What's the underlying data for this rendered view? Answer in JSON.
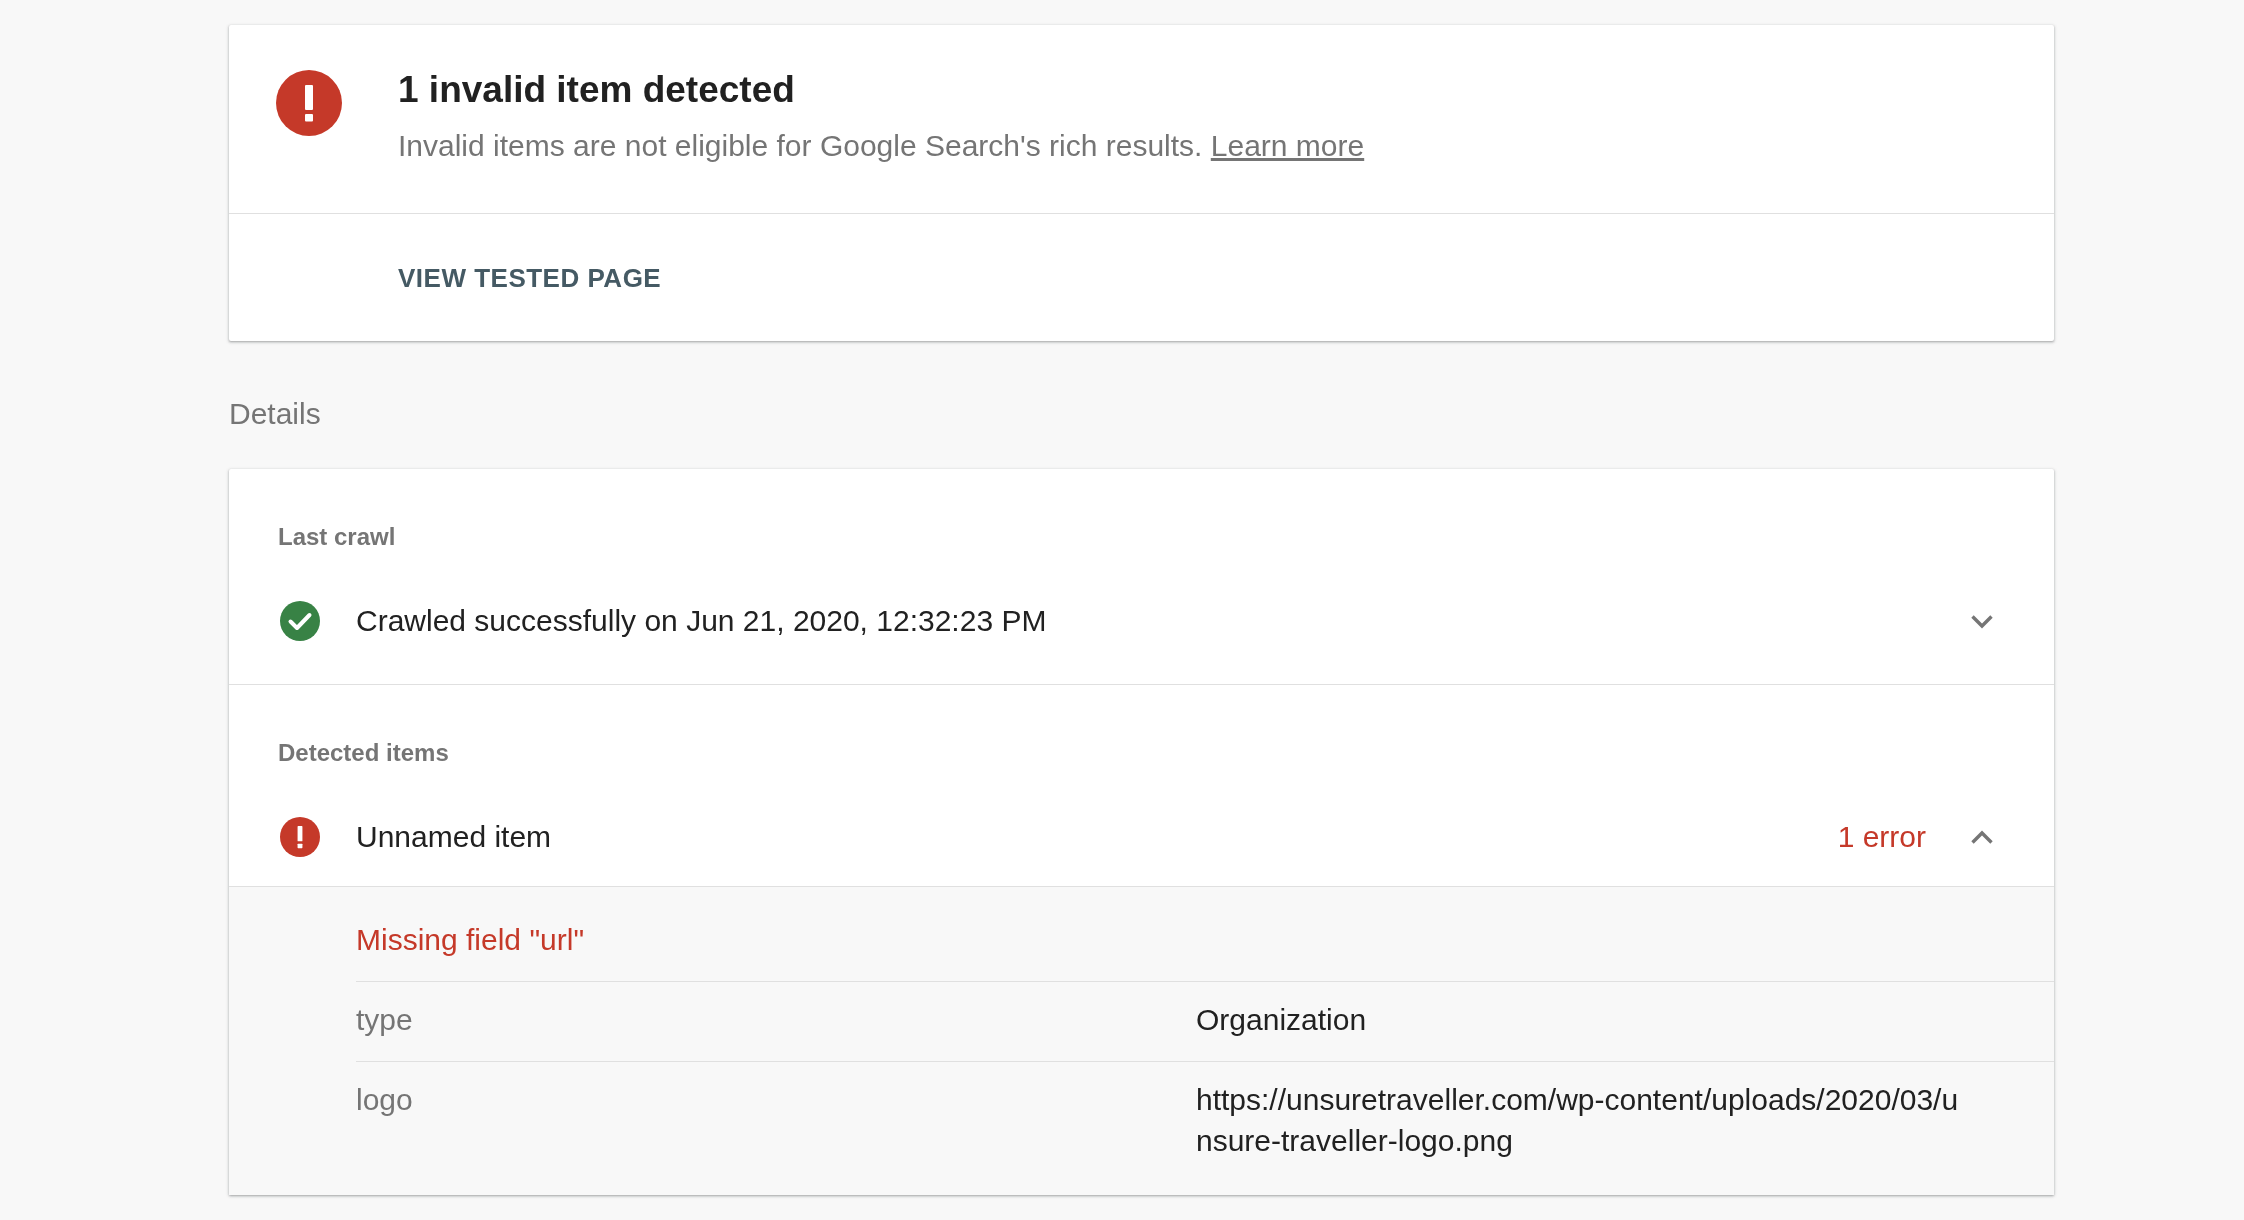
{
  "summary": {
    "kind": "error",
    "title": "1 invalid item detected",
    "description": "Invalid items are not eligible for Google Search's rich results.",
    "link": "Learn more",
    "action": "VIEW TESTED PAGE"
  },
  "details": {
    "heading": "Details",
    "sections": [
      {
        "label": "Last crawl",
        "kind": "success",
        "text": "Crawled successfully on Jun 21, 2020, 12:32:23 PM",
        "expanded": false
      },
      {
        "label": "Detected items",
        "kind": "error",
        "text": "Unnamed item",
        "count": "1 error",
        "expanded": true,
        "issues": [
          "Missing field \"url\""
        ],
        "fields": [
          {
            "name": "type",
            "value": "Organization"
          },
          {
            "name": "logo",
            "value": "https://unsuretraveller.com/wp-content/uploads/2020/03/unsure-traveller-logo.png"
          }
        ]
      }
    ]
  }
}
